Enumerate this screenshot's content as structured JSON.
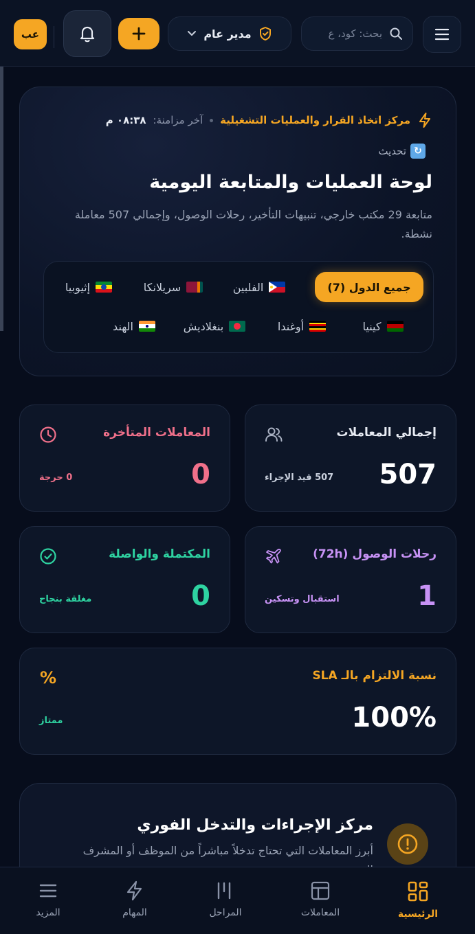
{
  "header": {
    "search_placeholder": "بحث: كود، ع",
    "role": "مدير عام",
    "lang": "عب"
  },
  "hero": {
    "center_name": "مركز اتخاذ القرار والعمليات التشغيلية",
    "sync_label": "آخر مزامنة:",
    "sync_time": "٠٨:٣٨ م",
    "refresh_label": "تحديث",
    "title": "لوحة العمليات والمتابعة اليومية",
    "description": "متابعة 29 مكتب خارجي، تنبيهات التأخير، رحلات الوصول، وإجمالي 507 معاملة نشطة.",
    "filters": [
      {
        "label": "جميع الدول (7)",
        "active": true
      },
      {
        "label": "الفلبين"
      },
      {
        "label": "سريلانكا"
      },
      {
        "label": "إثيوبيا"
      },
      {
        "label": "كينيا"
      },
      {
        "label": "أوغندا"
      },
      {
        "label": "بنغلاديش"
      },
      {
        "label": "الهند"
      }
    ]
  },
  "stats": {
    "total": {
      "title": "إجمالي المعاملات",
      "value": "507",
      "sub": "507 قيد الإجراء",
      "color": "#ffffff"
    },
    "late": {
      "title": "المعاملات المتأخرة",
      "value": "0",
      "sub": "0 حرجة",
      "color": "#f0708a"
    },
    "arrivals": {
      "title": "رحلات الوصول (72h)",
      "value": "1",
      "sub": "استقبال وتسكين",
      "color": "#c792f5"
    },
    "completed": {
      "title": "المكتملة والواصلة",
      "value": "0",
      "sub": "مغلقة بنجاح",
      "color": "#2ed3a1"
    },
    "sla": {
      "title": "نسبة الالتزام بالـ SLA",
      "value": "100%",
      "sub": "ممتاز",
      "icon_text": "%",
      "color": "#f5a623"
    }
  },
  "action_center": {
    "title": "مركز الإجراءات والتدخل الفوري",
    "description": "أبرز المعاملات التي تحتاج تدخلاً مباشراً من الموظف أو المشرف المختص."
  },
  "nav": [
    {
      "label": "الرئيسية",
      "active": true
    },
    {
      "label": "المعاملات"
    },
    {
      "label": "المراحل"
    },
    {
      "label": "المهام"
    },
    {
      "label": "المزيد"
    }
  ],
  "colors": {
    "accent": "#f5a623",
    "background": "#070d1c",
    "card": "#0d1628"
  }
}
